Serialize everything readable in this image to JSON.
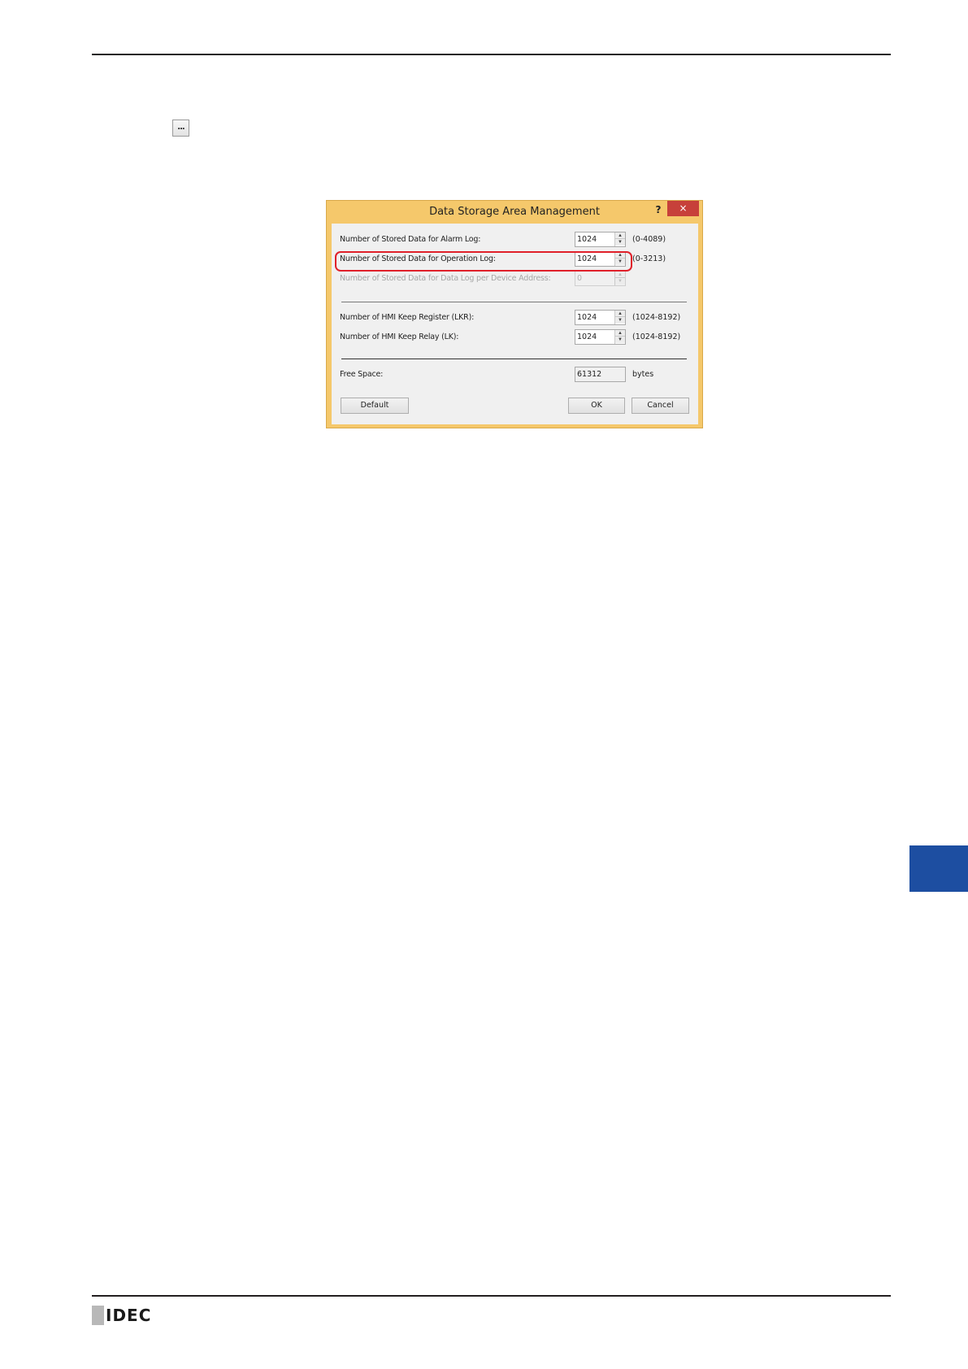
{
  "page": {
    "toolbar_button_label": "...",
    "logo_text": "IDEC"
  },
  "dialog": {
    "title": "Data Storage Area Management",
    "help_label": "?",
    "close_label": "×",
    "alarm_log": {
      "label": "Number of Stored Data for Alarm Log:",
      "value": "1024",
      "range": "(0-4089)"
    },
    "operation_log": {
      "label": "Number of Stored Data for Operation Log:",
      "value": "1024",
      "range": "(0-3213)"
    },
    "data_log": {
      "label": "Number of Stored Data for Data Log per Device Address:",
      "value": "0",
      "range": ""
    },
    "keep_register": {
      "label": "Number of HMI Keep Register (LKR):",
      "value": "1024",
      "range": "(1024-8192)"
    },
    "keep_relay": {
      "label": "Number of HMI Keep Relay (LK):",
      "value": "1024",
      "range": "(1024-8192)"
    },
    "free_space": {
      "label": "Free Space:",
      "value": "61312",
      "unit": "bytes"
    },
    "buttons": {
      "default": "Default",
      "ok": "OK",
      "cancel": "Cancel"
    }
  }
}
